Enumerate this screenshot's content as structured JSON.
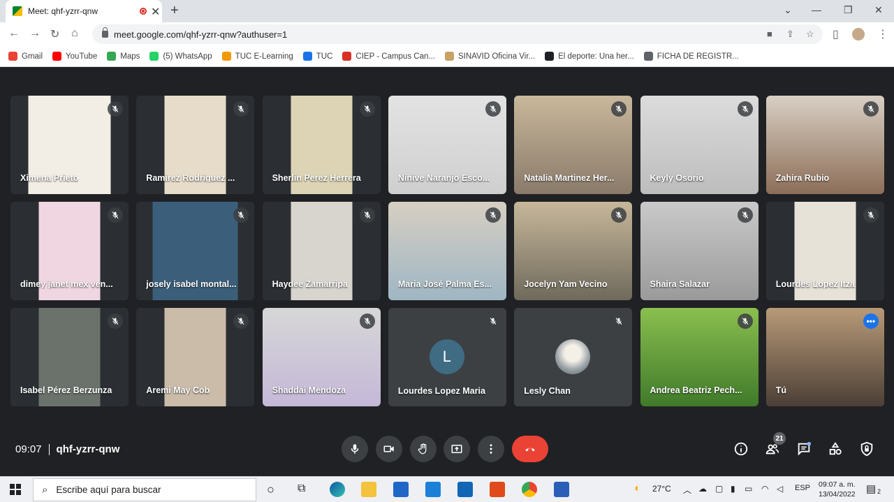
{
  "browser": {
    "tab_title": "Meet: qhf-yzrr-qnw",
    "url": "meet.google.com/qhf-yzrr-qnw?authuser=1",
    "bookmarks": [
      {
        "label": "Gmail",
        "color": "#ea4335"
      },
      {
        "label": "YouTube",
        "color": "#ff0000"
      },
      {
        "label": "Maps",
        "color": "#34a853"
      },
      {
        "label": "(5) WhatsApp",
        "color": "#25d366"
      },
      {
        "label": "TUC E-Learning",
        "color": "#f29900"
      },
      {
        "label": "TUC",
        "color": "#1a73e8"
      },
      {
        "label": "CIEP - Campus Can...",
        "color": "#d93025"
      },
      {
        "label": "SINAVID Oficina Vir...",
        "color": "#c8a165"
      },
      {
        "label": "El deporte: Una her...",
        "color": "#202124"
      },
      {
        "label": "FICHA DE REGISTR...",
        "color": "#5f6368"
      }
    ]
  },
  "participants": [
    {
      "name": "Ximena Prieto",
      "bg": "linear-gradient(90deg,#2b2f33 0 15%,#f2eee6 15% 85%,#2b2f33 85%)"
    },
    {
      "name": "Ramirez Rodriguez ...",
      "bg": "linear-gradient(90deg,#2b2f33 0 24%,#e6dcc9 24% 76%,#2b2f33 76%)"
    },
    {
      "name": "Sherlin Perez Herrera",
      "bg": "linear-gradient(90deg,#2b2f33 0 24%,#dcd4b5 24% 76%,#2b2f33 76%)"
    },
    {
      "name": "Ninive Naranjo Esco...",
      "bg": "linear-gradient(180deg,#e3e3e3,#cfcfcf)"
    },
    {
      "name": "Natalia Martinez Her...",
      "bg": "linear-gradient(180deg,#c9b89b,#8a7a6a)"
    },
    {
      "name": "Keyly Osorio",
      "bg": "linear-gradient(180deg,#dcdcdc,#bdbdbd)"
    },
    {
      "name": "Zahira Rubio",
      "bg": "linear-gradient(180deg,#d9cfc4,#8c6e58)"
    },
    {
      "name": "dimey janet mex ven...",
      "bg": "linear-gradient(90deg,#2b2f33 0 24%,#f0d6e0 24% 76%,#2b2f33 76%)"
    },
    {
      "name": "josely isabel montal...",
      "bg": "linear-gradient(90deg,#2b2f33 0 14%,#3b5f7a 14% 86%,#2b2f33 86%)"
    },
    {
      "name": "Haydee Zamarripa",
      "bg": "linear-gradient(90deg,#2b2f33 0 24%,#d8d4ce 24% 76%,#2b2f33 76%)"
    },
    {
      "name": "Maria José Palma Es...",
      "bg": "linear-gradient(180deg,#d6cfc2,#9fb6c4)"
    },
    {
      "name": "Jocelyn Yam Vecino",
      "bg": "linear-gradient(180deg,#c7b79a,#6f6a5c)"
    },
    {
      "name": "Shaira Salazar",
      "bg": "linear-gradient(180deg,#c9c9c9,#9a9a9a)"
    },
    {
      "name": "Lourdes Lopez Itza",
      "bg": "linear-gradient(90deg,#2b2f33 0 24%,#e6e2d8 24% 76%,#2b2f33 76%)"
    },
    {
      "name": "Isabel Pérez Berzunza",
      "bg": "linear-gradient(90deg,#2b2f33 0 24%,#6b726c 24% 76%,#2b2f33 76%)"
    },
    {
      "name": "Aremi May Cob",
      "bg": "linear-gradient(90deg,#2b2f33 0 24%,#cbbcaa 24% 76%,#2b2f33 76%)"
    },
    {
      "name": "Shaddai Mendoza",
      "bg": "linear-gradient(180deg,#d7d7d7,#c4b8d8)"
    },
    {
      "name": "Lourdes Lopez Maria",
      "bg": "#3c4043",
      "avatar_letter": "L"
    },
    {
      "name": "Lesly Chan",
      "bg": "#3c4043",
      "avatar_image": true
    },
    {
      "name": "Andrea Beatriz Pech...",
      "bg": "linear-gradient(180deg,#8bbf4f,#3f7a2a)"
    },
    {
      "name": "Tú",
      "bg": "linear-gradient(180deg,#b89a78,#4c3f36)"
    }
  ],
  "meeting": {
    "time": "09:07",
    "code": "qhf-yzrr-qnw",
    "people_count": "21"
  },
  "taskbar": {
    "search_placeholder": "Escribe aquí para buscar",
    "temperature": "27°C",
    "language": "ESP",
    "time": "09:07 a. m.",
    "date": "13/04/2022",
    "notifications": "2"
  }
}
